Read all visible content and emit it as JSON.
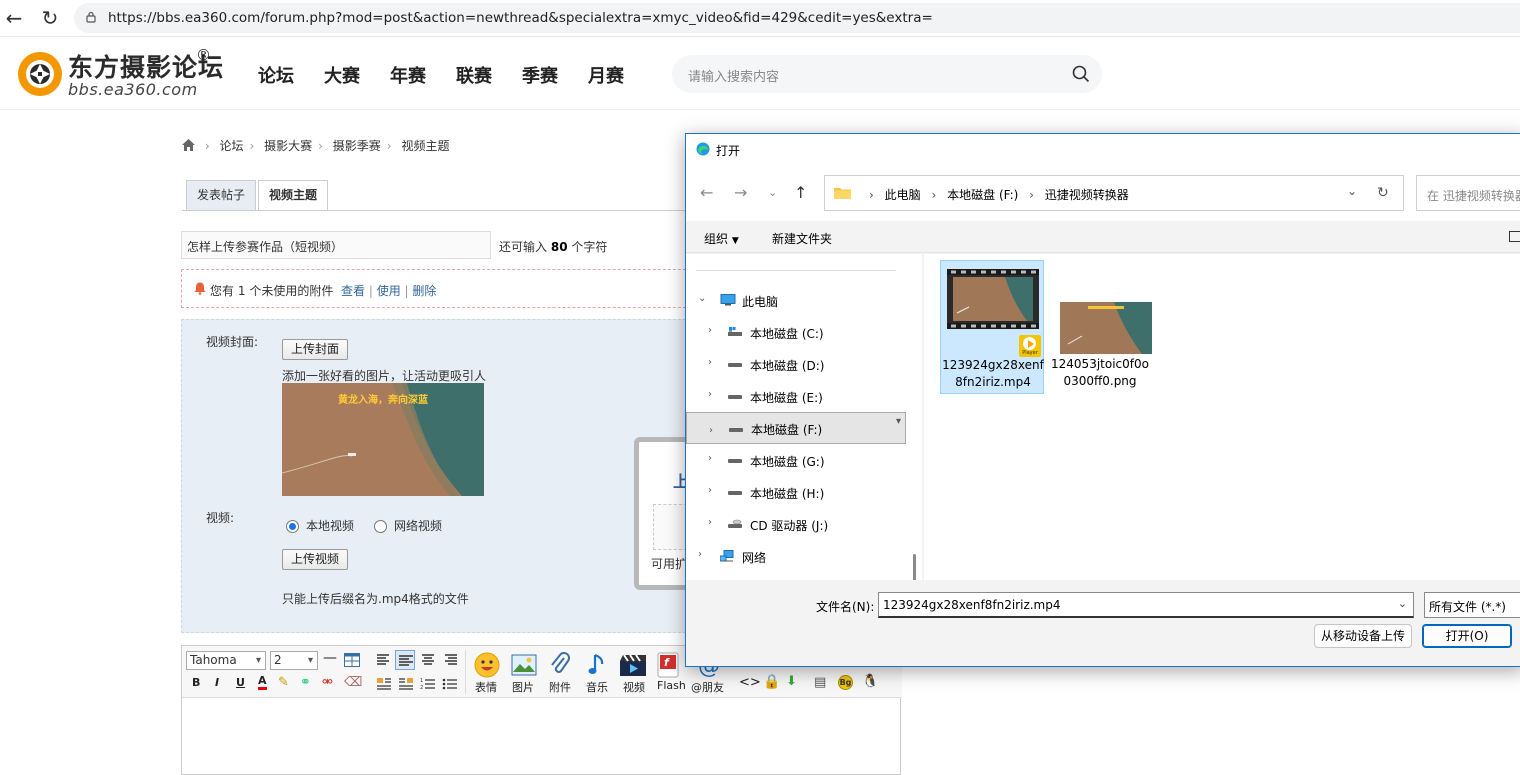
{
  "browser": {
    "url": "https://bbs.ea360.com/forum.php?mod=post&action=newthread&specialextra=xmyc_video&fid=429&cedit=yes&extra="
  },
  "site": {
    "logo_cn": "东方摄影论坛",
    "logo_reg": "®",
    "logo_en": "bbs.ea360.com",
    "nav": [
      "论坛",
      "大赛",
      "年赛",
      "联赛",
      "季赛",
      "月赛"
    ],
    "search_placeholder": "请输入搜索内容"
  },
  "breadcrumb": [
    "论坛",
    "摄影大赛",
    "摄影季赛",
    "视频主题"
  ],
  "tabs": {
    "post": "发表帖子",
    "video": "视频主题"
  },
  "title_input": {
    "value": "怎样上传参赛作品（短视频）"
  },
  "remain": {
    "prefix": "还可输入",
    "count": "80",
    "suffix": "个字符"
  },
  "attach": {
    "text_prefix": "您有",
    "count": "1",
    "text_suffix": "个未使用的附件",
    "view": "查看",
    "use": "使用",
    "delete": "删除",
    "pipe": "|"
  },
  "video_form": {
    "cover_label": "视频封面:",
    "upload_cover": "上传封面",
    "cover_hint": "添加一张好看的图片，让活动更吸引人",
    "cover_caption": "黄龙入海，奔向深蓝",
    "video_label": "视频:",
    "local_video": "本地视频",
    "network_video": "网络视频",
    "upload_video": "上传视频",
    "format_hint": "只能上传后缀名为.mp4格式的文件"
  },
  "upload_modal": {
    "title_char": "上",
    "foot_text": "可用扩"
  },
  "editor": {
    "font": "Tahoma",
    "size": "2",
    "buttons": [
      "B",
      "I",
      "U",
      "A"
    ],
    "big_buttons": [
      "表情",
      "图片",
      "附件",
      "音乐",
      "视频",
      "Flash",
      "@朋友"
    ],
    "bg_badge": "Bg"
  },
  "dialog": {
    "title": "打开",
    "path": [
      "此电脑",
      "本地磁盘 (F:)",
      "迅捷视频转换器"
    ],
    "search_placeholder": "在 迅捷视频转换器",
    "organize": "组织",
    "new_folder": "新建文件夹",
    "nav": [
      {
        "label": "此电脑",
        "expanded": true
      },
      {
        "label": "本地磁盘 (C:)"
      },
      {
        "label": "本地磁盘 (D:)"
      },
      {
        "label": "本地磁盘 (E:)"
      },
      {
        "label": "本地磁盘 (F:)",
        "selected": true
      },
      {
        "label": "本地磁盘 (G:)"
      },
      {
        "label": "本地磁盘 (H:)"
      },
      {
        "label": "CD 驱动器 (J:)"
      },
      {
        "label": "网络"
      }
    ],
    "files": [
      {
        "name": "123924gx28xenf8fn2iriz.mp4",
        "selected": true,
        "badge": "Player"
      },
      {
        "name": "124053jtoic0f0o0300ff0.png"
      }
    ],
    "filename_label": "文件名(N):",
    "filename_value": "123924gx28xenf8fn2iriz.mp4",
    "filetype": "所有文件 (*.*)",
    "mobile_upload": "从移动设备上传",
    "open": "打开(O)"
  },
  "colors": {
    "accent": "#1a73c6",
    "selection": "#cce8ff",
    "link": "#336699",
    "logo_orange": "#f39800"
  }
}
